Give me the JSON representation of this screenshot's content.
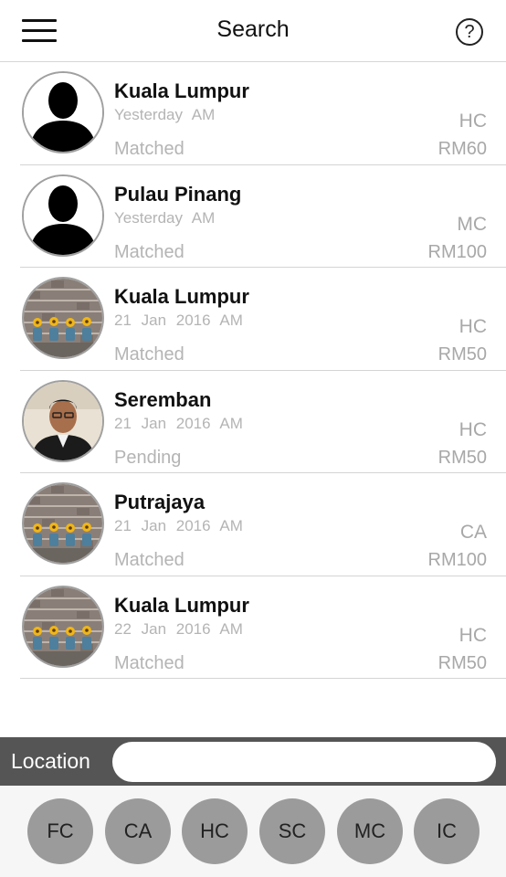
{
  "header": {
    "title": "Search",
    "help_symbol": "?",
    "menu_icon": "hamburger-menu-icon",
    "help_icon": "question-circle-icon"
  },
  "results": [
    {
      "city": "Kuala Lumpur",
      "date": "Yesterday AM",
      "status": "Matched",
      "court": "HC",
      "price": "RM60",
      "avatar": "silhouette"
    },
    {
      "city": "Pulau Pinang",
      "date": "Yesterday AM",
      "status": "Matched",
      "court": "MC",
      "price": "RM100",
      "avatar": "silhouette"
    },
    {
      "city": "Kuala Lumpur",
      "date": "21 Jan 2016 AM",
      "status": "Matched",
      "court": "HC",
      "price": "RM50",
      "avatar": "brick-wall-flowers"
    },
    {
      "city": "Seremban",
      "date": "21 Jan 2016 AM",
      "status": "Pending",
      "court": "HC",
      "price": "RM50",
      "avatar": "person-photo"
    },
    {
      "city": "Putrajaya",
      "date": "21 Jan 2016 AM",
      "status": "Matched",
      "court": "CA",
      "price": "RM100",
      "avatar": "brick-wall-flowers"
    },
    {
      "city": "Kuala Lumpur",
      "date": "22 Jan 2016 AM",
      "status": "Matched",
      "court": "HC",
      "price": "RM50",
      "avatar": "brick-wall-flowers"
    }
  ],
  "location": {
    "label": "Location",
    "value": "",
    "placeholder": ""
  },
  "court_filters": [
    "FC",
    "CA",
    "HC",
    "SC",
    "MC",
    "IC"
  ],
  "colors": {
    "location_bar": "#555555",
    "court_button": "#9b9b9b",
    "muted_text": "#b4b4b4"
  }
}
